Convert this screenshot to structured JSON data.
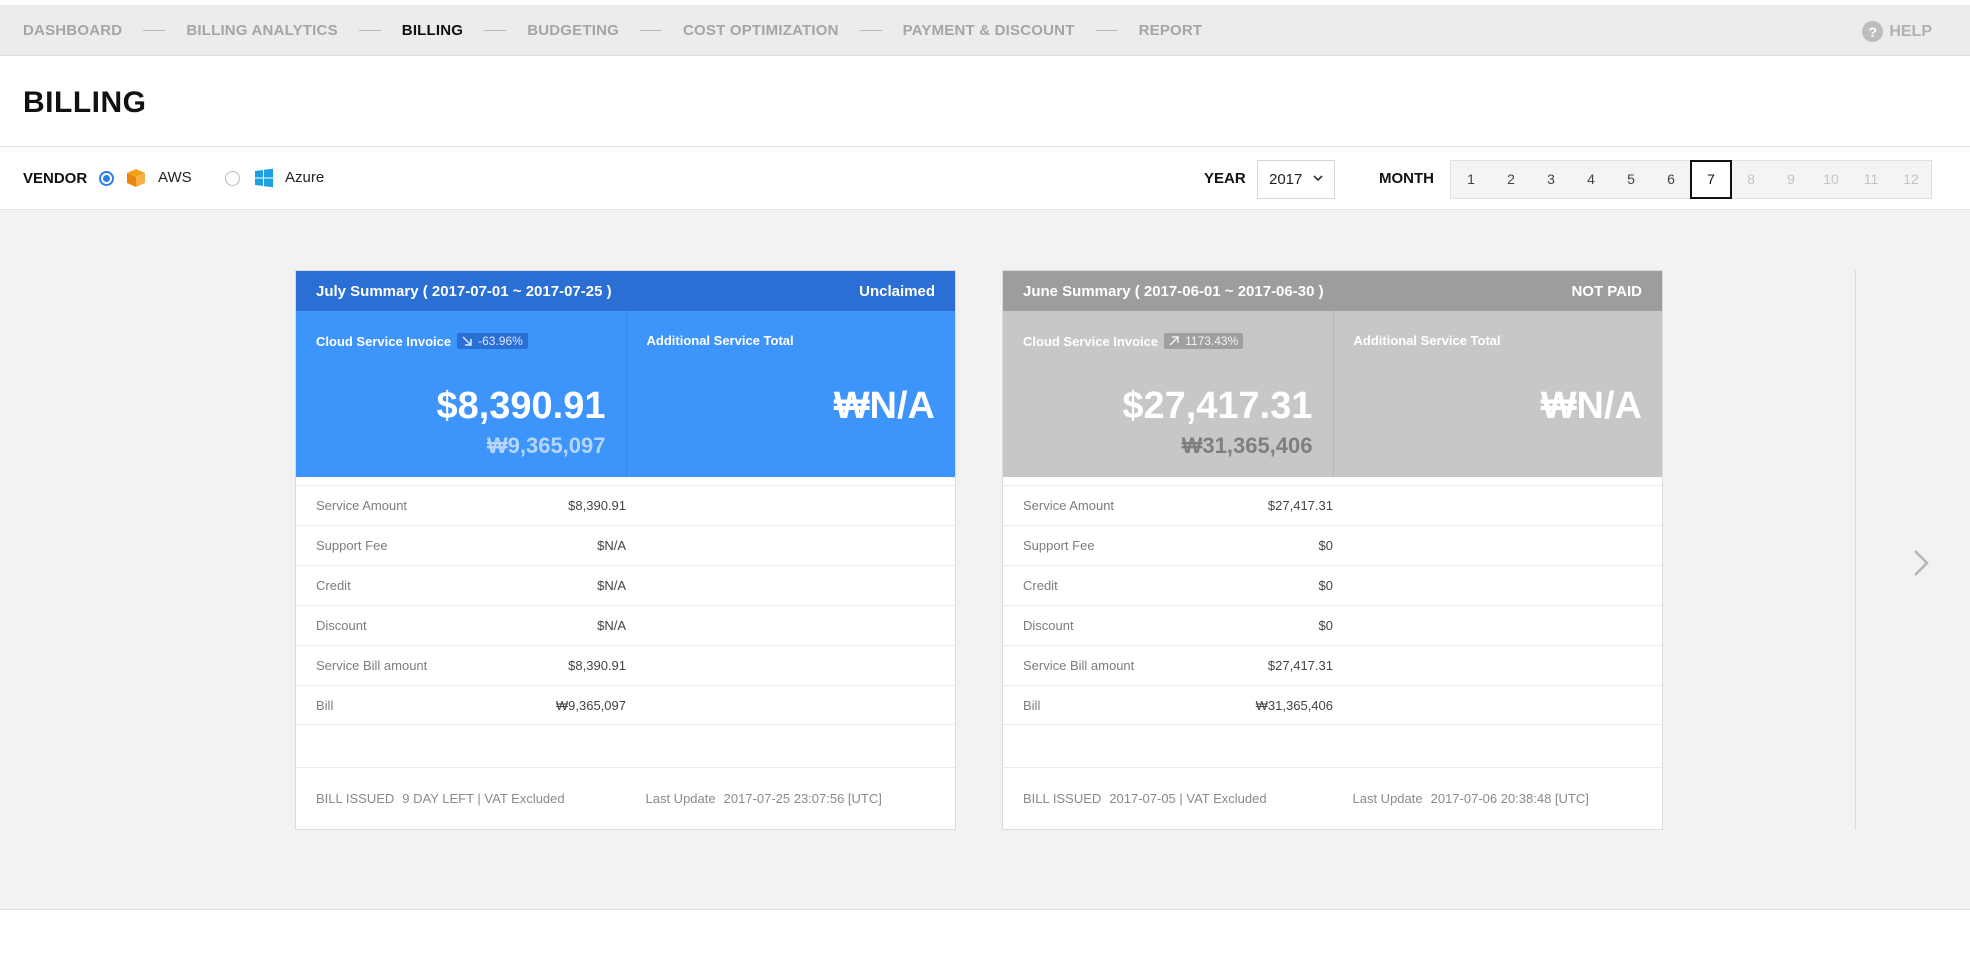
{
  "nav": {
    "items": [
      {
        "label": "DASHBOARD",
        "active": false
      },
      {
        "label": "BILLING ANALYTICS",
        "active": false
      },
      {
        "label": "BILLING",
        "active": true
      },
      {
        "label": "BUDGETING",
        "active": false
      },
      {
        "label": "COST OPTIMIZATION",
        "active": false
      },
      {
        "label": "PAYMENT & DISCOUNT",
        "active": false
      },
      {
        "label": "REPORT",
        "active": false
      }
    ],
    "help_label": "HELP",
    "help_icon": "?"
  },
  "page": {
    "title": "BILLING"
  },
  "filters": {
    "vendor_label": "VENDOR",
    "vendors": [
      {
        "label": "AWS",
        "selected": true,
        "icon": "aws-box-icon"
      },
      {
        "label": "Azure",
        "selected": false,
        "icon": "windows-icon"
      }
    ],
    "year_label": "YEAR",
    "year_value": "2017",
    "month_label": "MONTH",
    "months": [
      "1",
      "2",
      "3",
      "4",
      "5",
      "6",
      "7",
      "8",
      "9",
      "10",
      "11",
      "12"
    ],
    "selected_month": "7",
    "enabled_up_to": 7
  },
  "cards": [
    {
      "theme": "blue",
      "title": "July Summary ( 2017-07-01 ~ 2017-07-25 )",
      "status": "Unclaimed",
      "invoice_label": "Cloud Service Invoice",
      "change_pct": "-63.96%",
      "change_dir": "down",
      "invoice_usd": "$8,390.91",
      "invoice_krw": "₩9,365,097",
      "additional_label": "Additional Service Total",
      "additional_value": "₩N/A",
      "rows": [
        {
          "label": "Service Amount",
          "value": "$8,390.91"
        },
        {
          "label": "Support Fee",
          "value": "$N/A"
        },
        {
          "label": "Credit",
          "value": "$N/A"
        },
        {
          "label": "Discount",
          "value": "$N/A"
        },
        {
          "label": "Service Bill amount",
          "value": "$8,390.91"
        },
        {
          "label": "Bill",
          "value": "₩9,365,097"
        }
      ],
      "bill_issued_label": "BILL ISSUED",
      "bill_issued_value": "9 DAY LEFT | VAT Excluded",
      "last_update_label": "Last Update",
      "last_update_value": "2017-07-25 23:07:56 [UTC]"
    },
    {
      "theme": "grey",
      "title": "June Summary ( 2017-06-01 ~ 2017-06-30 )",
      "status": "NOT PAID",
      "invoice_label": "Cloud Service Invoice",
      "change_pct": "1173.43%",
      "change_dir": "up",
      "invoice_usd": "$27,417.31",
      "invoice_krw": "₩31,365,406",
      "additional_label": "Additional Service Total",
      "additional_value": "₩N/A",
      "rows": [
        {
          "label": "Service Amount",
          "value": "$27,417.31"
        },
        {
          "label": "Support Fee",
          "value": "$0"
        },
        {
          "label": "Credit",
          "value": "$0"
        },
        {
          "label": "Discount",
          "value": "$0"
        },
        {
          "label": "Service Bill amount",
          "value": "$27,417.31"
        },
        {
          "label": "Bill",
          "value": "₩31,365,406"
        }
      ],
      "bill_issued_label": "BILL ISSUED",
      "bill_issued_value": "2017-07-05 | VAT Excluded",
      "last_update_label": "Last Update",
      "last_update_value": "2017-07-06 20:38:48 [UTC]"
    }
  ],
  "colors": {
    "accent_blue": "#3d94fa",
    "header_blue": "#2b6fd4",
    "grey_panel": "#c7c7c7",
    "header_grey": "#9d9d9d"
  }
}
